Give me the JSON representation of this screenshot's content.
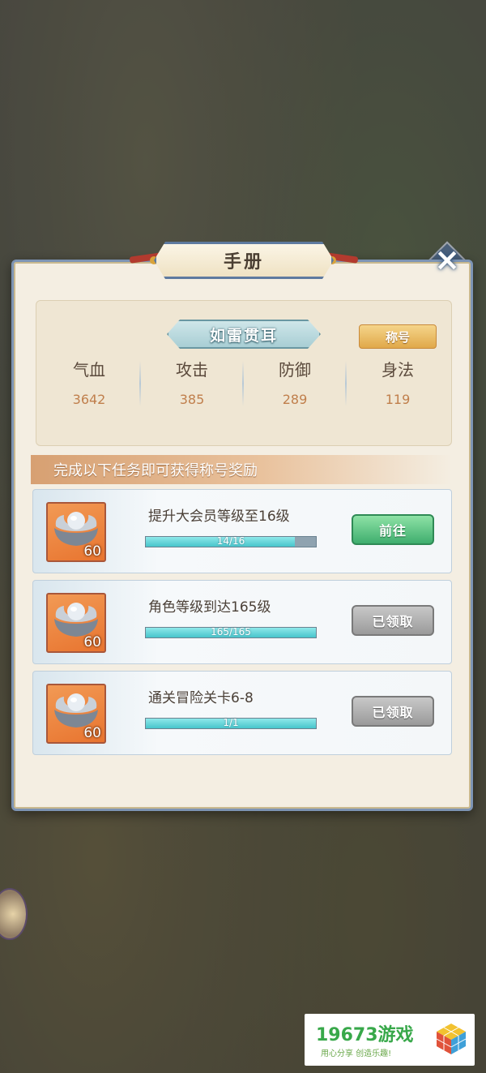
{
  "dialog": {
    "title": "手册",
    "close_icon": "close-icon"
  },
  "profile": {
    "title_name": "如雷贯耳",
    "title_button": "称号",
    "stats": [
      {
        "name": "气血",
        "value": "3642"
      },
      {
        "name": "攻击",
        "value": "385"
      },
      {
        "name": "防御",
        "value": "289"
      },
      {
        "name": "身法",
        "value": "119"
      }
    ]
  },
  "tasks_header": "完成以下任务即可获得称号奖励",
  "tasks": [
    {
      "label": "提升大会员等级至16级",
      "progress_text": "14/16",
      "progress": 0.875,
      "reward_icon": "silver-ingot-icon",
      "reward_count": "60",
      "button": "前往",
      "state": "go"
    },
    {
      "label": "角色等级到达165级",
      "progress_text": "165/165",
      "progress": 1.0,
      "reward_icon": "silver-ingot-icon",
      "reward_count": "60",
      "button": "已领取",
      "state": "done"
    },
    {
      "label": "通关冒险关卡6-8",
      "progress_text": "1/1",
      "progress": 1.0,
      "reward_icon": "silver-ingot-icon",
      "reward_count": "60",
      "button": "已领取",
      "state": "done"
    }
  ],
  "watermark": {
    "main": "19673游戏",
    "sub": "用心分享 创造乐趣!"
  },
  "colors": {
    "accent_blue": "#5e7a9f",
    "stat_value": "#c07f4c",
    "go_button": "#3fae6e",
    "progress_fill": "#47c5cb"
  }
}
